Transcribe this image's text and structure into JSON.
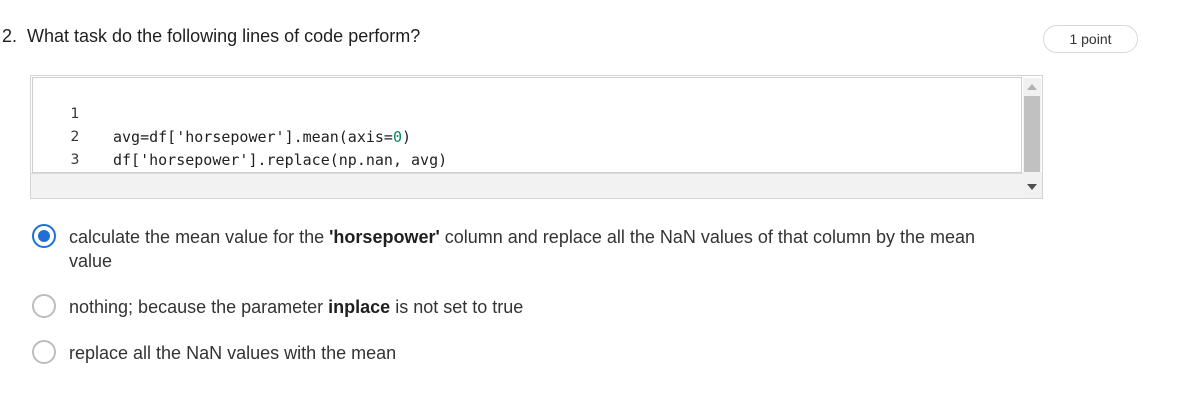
{
  "question": {
    "number": "2.",
    "text": "What task do the following lines of code perform?",
    "points": "1 point"
  },
  "code": {
    "lines": [
      {
        "num": "1",
        "pre": "avg=df['horsepower'].mean(axis=",
        "num_token": "0",
        "post": ")"
      },
      {
        "num": "2",
        "pre": "df['horsepower'].replace(np.nan, avg)",
        "num_token": "",
        "post": ""
      },
      {
        "num": "3",
        "pre": "",
        "num_token": "",
        "post": ""
      }
    ]
  },
  "options": [
    {
      "selected": true,
      "parts": [
        {
          "text": "calculate the mean value for the ",
          "bold": false
        },
        {
          "text": "'horsepower'",
          "bold": true
        },
        {
          "text": " column and replace all the NaN values of that column by the mean value",
          "bold": false
        }
      ]
    },
    {
      "selected": false,
      "parts": [
        {
          "text": "nothing; because the parameter ",
          "bold": false
        },
        {
          "text": "inplace",
          "bold": true
        },
        {
          "text": " is not set to true",
          "bold": false
        }
      ]
    },
    {
      "selected": false,
      "parts": [
        {
          "text": "replace all the NaN values with the mean",
          "bold": false
        }
      ]
    }
  ],
  "colors": {
    "accent": "#1f6fd6",
    "code_number": "#098658"
  }
}
